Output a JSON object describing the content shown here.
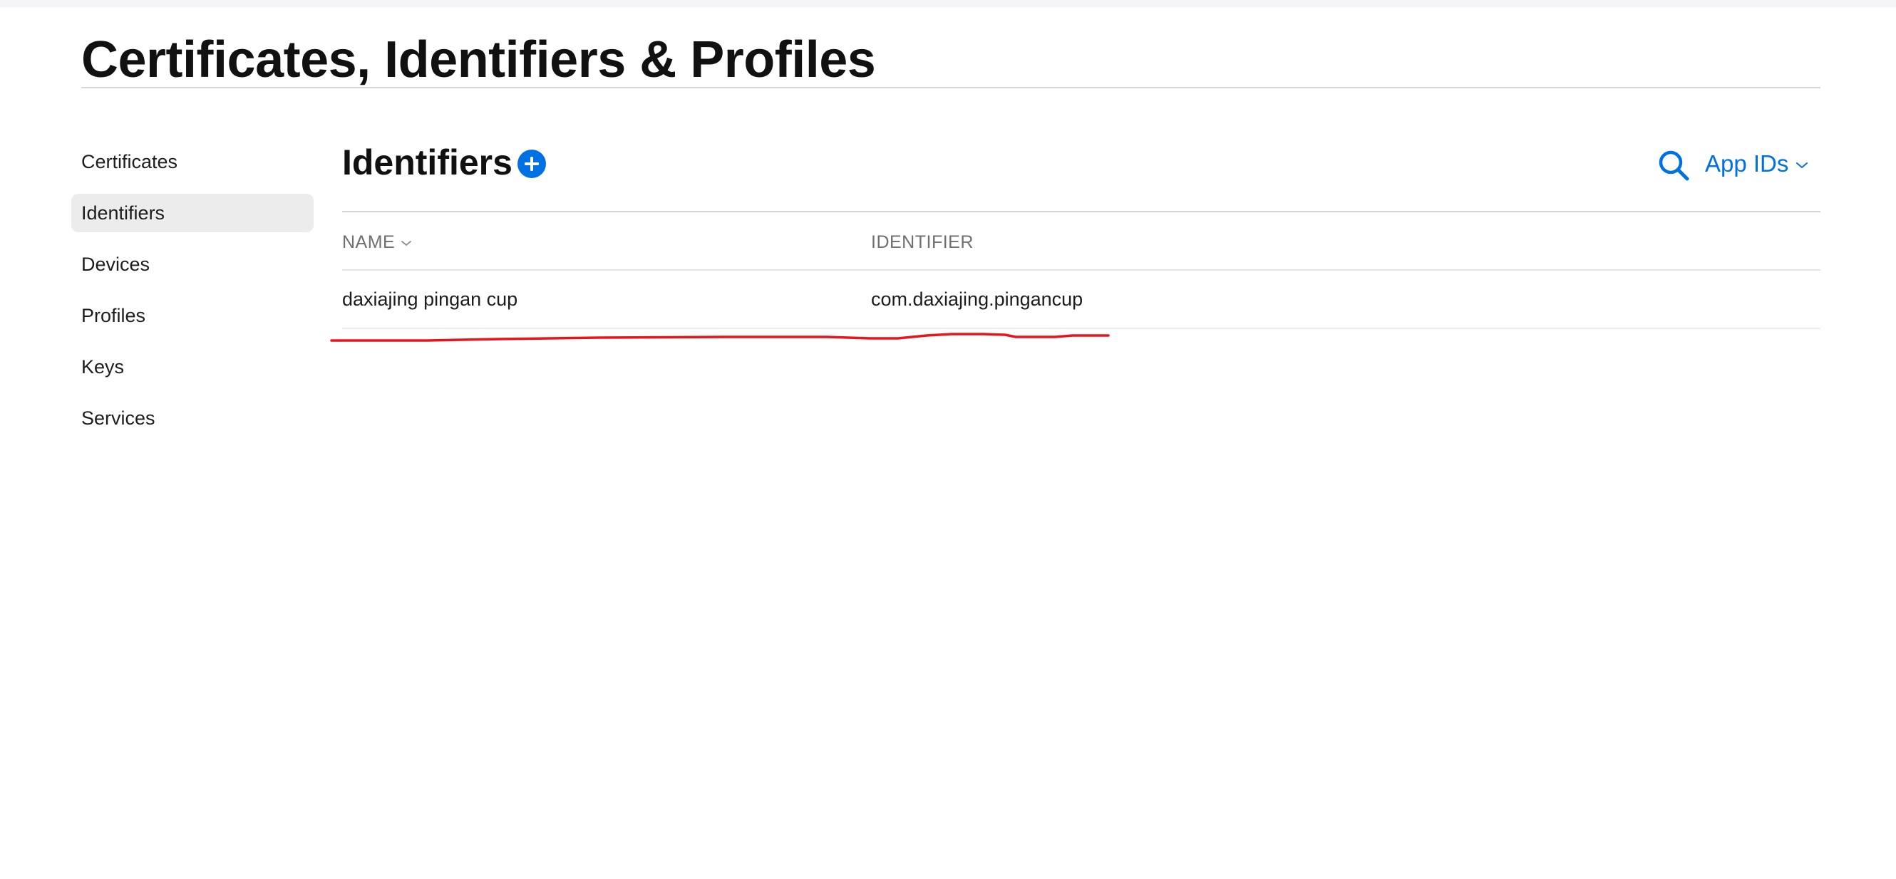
{
  "page": {
    "title": "Certificates, Identifiers & Profiles"
  },
  "sidebar": {
    "items": [
      {
        "label": "Certificates",
        "active": false
      },
      {
        "label": "Identifiers",
        "active": true
      },
      {
        "label": "Devices",
        "active": false
      },
      {
        "label": "Profiles",
        "active": false
      },
      {
        "label": "Keys",
        "active": false
      },
      {
        "label": "Services",
        "active": false
      }
    ]
  },
  "main": {
    "section_title": "Identifiers",
    "add_icon": "plus-circle-icon",
    "search_icon": "search-icon",
    "filter": {
      "selected": "App IDs",
      "icon": "chevron-down-icon"
    },
    "table": {
      "columns": [
        {
          "label": "NAME",
          "sortable": true
        },
        {
          "label": "IDENTIFIER",
          "sortable": false
        }
      ],
      "rows": [
        {
          "name": "daxiajing pingan cup",
          "identifier": "com.daxiajing.pingancup"
        }
      ]
    }
  },
  "colors": {
    "accent": "#0071e3",
    "annotation": "#e8141c",
    "active_bg": "#ececec"
  }
}
